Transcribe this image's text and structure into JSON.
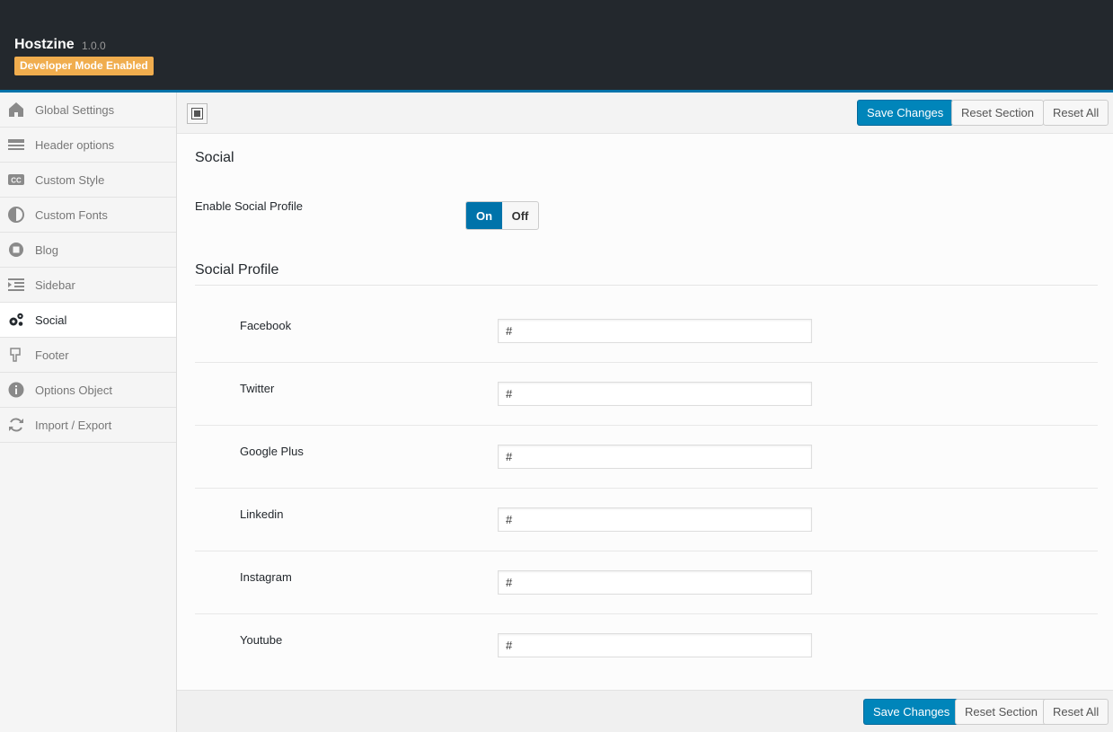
{
  "header": {
    "app_name": "Hostzine",
    "version": "1.0.0",
    "badge": "Developer Mode Enabled"
  },
  "colors": {
    "accent": "#0073aa",
    "header_bg": "#23282d",
    "badge_bg": "#f0ad4e",
    "primary_button": "#0085ba"
  },
  "sidebar": {
    "items": [
      {
        "label": "Global Settings",
        "icon": "home-icon"
      },
      {
        "label": "Header options",
        "icon": "header-icon"
      },
      {
        "label": "Custom Style",
        "icon": "cc-icon"
      },
      {
        "label": "Custom Fonts",
        "icon": "contrast-icon"
      },
      {
        "label": "Blog",
        "icon": "blog-icon"
      },
      {
        "label": "Sidebar",
        "icon": "indent-icon"
      },
      {
        "label": "Social",
        "icon": "cogs-icon",
        "active": true
      },
      {
        "label": "Footer",
        "icon": "hand-down-icon"
      },
      {
        "label": "Options Object",
        "icon": "info-icon"
      },
      {
        "label": "Import / Export",
        "icon": "refresh-icon"
      }
    ]
  },
  "toolbar": {
    "save_label": "Save Changes",
    "reset_section_label": "Reset Section",
    "reset_all_label": "Reset All"
  },
  "section": {
    "title": "Social",
    "enable_label": "Enable Social Profile",
    "switch_on": "On",
    "switch_off": "Off",
    "enabled": true,
    "profile_title": "Social Profile",
    "fields": [
      {
        "label": "Facebook",
        "value": "#"
      },
      {
        "label": "Twitter",
        "value": "#"
      },
      {
        "label": "Google Plus",
        "value": "#"
      },
      {
        "label": "Linkedin",
        "value": "#"
      },
      {
        "label": "Instagram",
        "value": "#"
      },
      {
        "label": "Youtube",
        "value": "#"
      }
    ]
  },
  "footer": {
    "save_label": "Save Changes",
    "reset_section_label": "Reset Section",
    "reset_all_label": "Reset All"
  }
}
